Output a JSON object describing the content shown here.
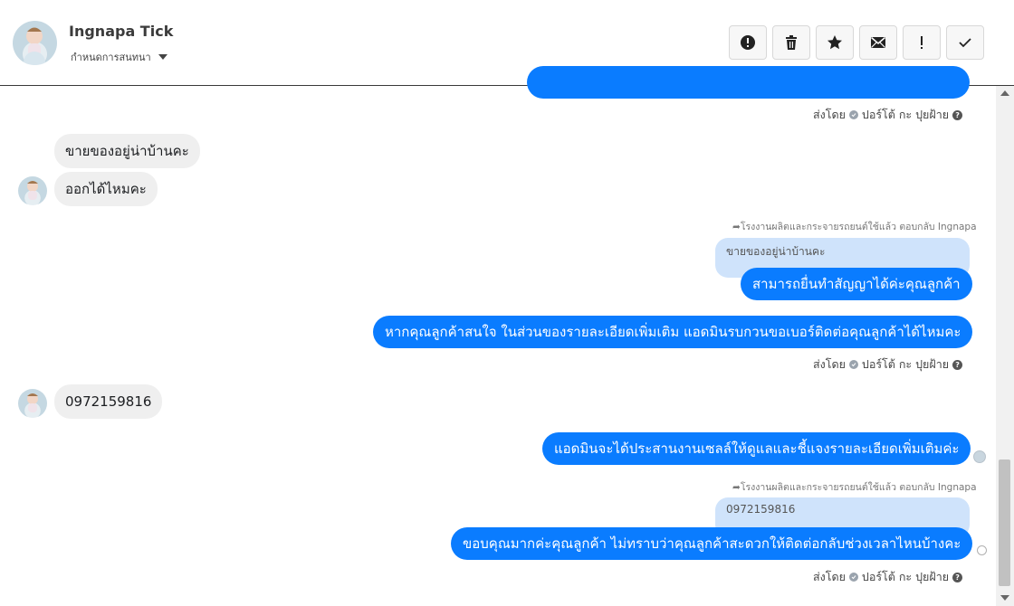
{
  "contact": {
    "name": "Ingnapa Tick",
    "assign_label": "กำหนดการสนทนา"
  },
  "toolbar": {
    "actions": [
      {
        "name": "spam",
        "icon": "alert-circle-icon"
      },
      {
        "name": "delete",
        "icon": "trash-icon"
      },
      {
        "name": "star",
        "icon": "star-icon"
      },
      {
        "name": "unread",
        "icon": "envelope-icon"
      },
      {
        "name": "important",
        "icon": "exclamation-icon"
      },
      {
        "name": "done",
        "icon": "check-icon"
      }
    ]
  },
  "messages": {
    "m1_meta": {
      "sent_by": "ส่งโดย",
      "author": "ปอร์โต้ กะ ปุยฝ้าย"
    },
    "in1": "ขายของอยู่น่าบ้านคะ",
    "in2": "ออกได้ไหมคะ",
    "reply_note_1": "โรงงานผลิตและกระจายรถยนต์ใช้แล้ว ตอบกลับ Ingnapa",
    "quote_1": "ขายของอยู่น่าบ้านคะ",
    "out1": "สามารถยื่นทำสัญญาได้ค่ะคุณลูกค้า",
    "out2": "หากคุณลูกค้าสนใจ ในส่วนของรายละเอียดเพิ่มเติม แอดมินรบกวนขอเบอร์ติดต่อคุณลูกค้าได้ไหมคะ",
    "m2_meta": {
      "sent_by": "ส่งโดย",
      "author": "ปอร์โต้ กะ ปุยฝ้าย"
    },
    "in3": "0972159816",
    "out3": "แอดมินจะได้ประสานงานเซลล์ให้ดูแลและชี้แจงรายละเอียดเพิ่มเติมค่ะ",
    "reply_note_2": "โรงงานผลิตและกระจายรถยนต์ใช้แล้ว ตอบกลับ Ingnapa",
    "quote_2": "0972159816",
    "out4": "ขอบคุณมากค่ะคุณลูกค้า ไม่ทราบว่าคุณลูกค้าสะดวกให้ติดต่อกลับช่วงเวลาไหนบ้างคะ",
    "m3_meta": {
      "sent_by": "ส่งโดย",
      "author": "ปอร์โต้ กะ ปุยฝ้าย"
    }
  },
  "colors": {
    "outgoing_bubble": "#0a7cff",
    "incoming_bubble": "#efefef",
    "quote_bubble": "#cfe3fb"
  }
}
